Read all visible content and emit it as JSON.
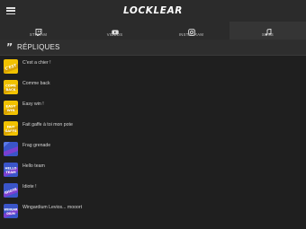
{
  "header": {
    "logo_text": "LOCKLEAR",
    "menu_icon": "hamburger-menu-icon"
  },
  "tabs": [
    {
      "label": "STREAM",
      "icon": "twitch-icon",
      "active": false
    },
    {
      "label": "VIDÉOS",
      "icon": "youtube-icon",
      "active": false
    },
    {
      "label": "INSTAGRAM",
      "icon": "instagram-icon",
      "active": false
    },
    {
      "label": "SONS",
      "icon": "music-note-icon",
      "active": true
    }
  ],
  "section": {
    "icon": "quote-icon",
    "title": "RÉPLIQUES"
  },
  "items": [
    {
      "label": "C'est a chier !",
      "thumb_style": "yellow"
    },
    {
      "label": "Comme back",
      "thumb_style": "yellow"
    },
    {
      "label": "Easy win !",
      "thumb_style": "yellow"
    },
    {
      "label": "Fait gaffe à toi mon pote",
      "thumb_style": "yellow"
    },
    {
      "label": "Frag grenade",
      "thumb_style": "blue"
    },
    {
      "label": "Hello team",
      "thumb_style": "blue"
    },
    {
      "label": "Idiote !",
      "thumb_style": "blue"
    },
    {
      "label": "Wingardium Levios... mooort",
      "thumb_style": "blue"
    }
  ],
  "colors": {
    "yellow_thumb": "#f2c200",
    "blue_thumb": "#3a55c9",
    "purple_thumb": "#7b3fd0",
    "background": "#1f1f1f"
  }
}
